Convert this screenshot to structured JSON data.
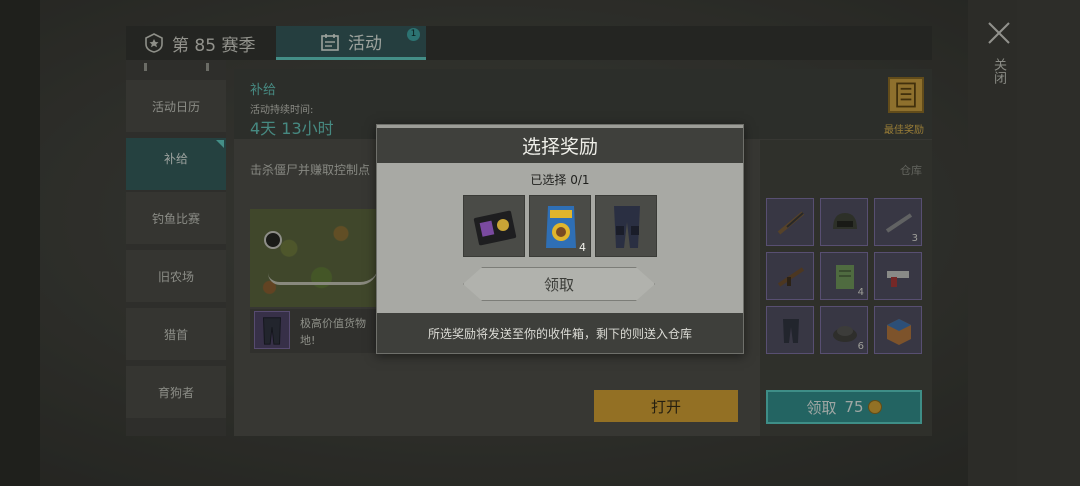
{
  "tabs": {
    "season_label": "第 85 赛季",
    "activity_label": "活动",
    "activity_badge": "1"
  },
  "close": {
    "label": "关闭"
  },
  "sidebar": {
    "items": [
      {
        "label": "活动日历"
      },
      {
        "label": "补给"
      },
      {
        "label": "钓鱼比赛"
      },
      {
        "label": "旧农场"
      },
      {
        "label": "猎首"
      },
      {
        "label": "育狗者"
      }
    ]
  },
  "main": {
    "title": "补给",
    "duration_caption": "活动持续时间:",
    "duration_value": "4天 13小时",
    "best_reward_label": "最佳奖励",
    "description": "击杀僵尸并赚取控制点",
    "reward_text": "极高价值货物\n地!",
    "open_button": "打开"
  },
  "warehouse": {
    "label": "仓库",
    "cells": [
      {
        "icon": "rifle-icon",
        "count": ""
      },
      {
        "icon": "helmet-icon",
        "count": ""
      },
      {
        "icon": "scope-icon",
        "count": "3"
      },
      {
        "icon": "assault-rifle-icon",
        "count": ""
      },
      {
        "icon": "notebook-icon",
        "count": "4"
      },
      {
        "icon": "pistol-icon",
        "count": ""
      },
      {
        "icon": "pants-icon",
        "count": ""
      },
      {
        "icon": "ore-icon",
        "count": "6"
      },
      {
        "icon": "crate-icon",
        "count": ""
      }
    ],
    "claim_label": "领取",
    "claim_cost": "75"
  },
  "modal": {
    "title": "选择奖励",
    "selected": "已选择 0/1",
    "options": [
      {
        "icon": "badge-wallet-icon",
        "count": ""
      },
      {
        "icon": "dog-food-icon",
        "count": "4"
      },
      {
        "icon": "armor-pants-icon",
        "count": ""
      }
    ],
    "claim_label": "领取",
    "footer": "所选奖励将发送至你的收件箱，剩下的则送入仓库"
  },
  "colors": {
    "accent_teal": "#62c8bd",
    "gold": "#d7a12f",
    "epic_purple": "#7b69a3"
  }
}
